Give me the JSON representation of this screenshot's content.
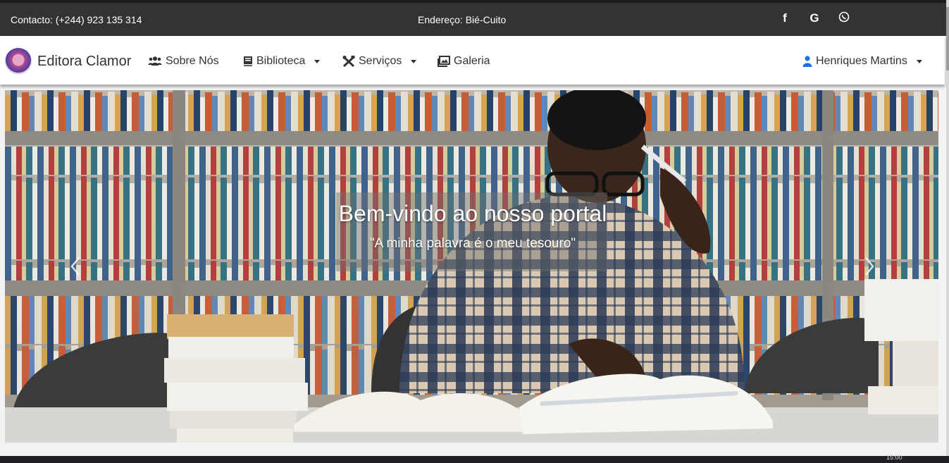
{
  "topbar": {
    "contact": "Contacto: (+244) 923 135 314",
    "address": "Endereço: Bié-Cuito",
    "social": {
      "facebook": "f",
      "google": "G",
      "whatsapp": "whatsapp-icon"
    }
  },
  "navbar": {
    "brand": "Editora Clamor",
    "items": [
      {
        "label": "Sobre Nós",
        "icon": "users-icon"
      },
      {
        "label": "Biblioteca",
        "icon": "book-icon",
        "dropdown": true
      },
      {
        "label": "Serviços",
        "icon": "tools-icon",
        "dropdown": true
      },
      {
        "label": "Galeria",
        "icon": "images-icon"
      }
    ],
    "user": {
      "label": "Henriques Martins",
      "icon": "user-icon",
      "dropdown": true
    }
  },
  "hero": {
    "title": "Bem-vindo ao nosso portal",
    "subtitle": "\"A minha palavra é o meu tesouro\""
  },
  "taskbar": {
    "clock": "15:00"
  }
}
